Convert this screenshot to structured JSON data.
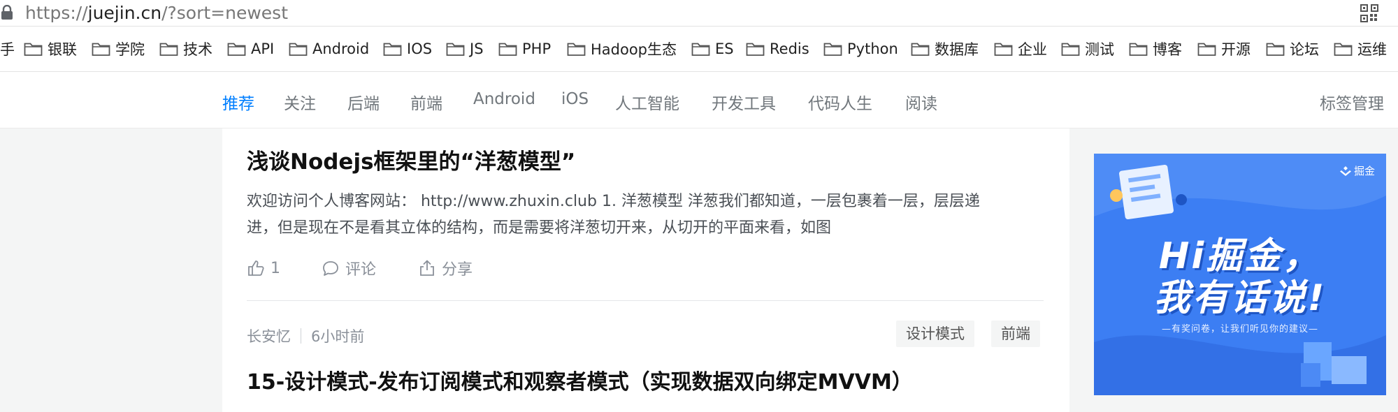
{
  "address_bar": {
    "url_scheme": "https://",
    "url_domain": "juejin.cn",
    "url_path": "/?sort=newest"
  },
  "bookmarks": [
    {
      "label": "手"
    },
    {
      "label": "银联"
    },
    {
      "label": "学院"
    },
    {
      "label": "技术"
    },
    {
      "label": "API"
    },
    {
      "label": "Android"
    },
    {
      "label": "IOS"
    },
    {
      "label": "JS"
    },
    {
      "label": "PHP"
    },
    {
      "label": "Hadoop生态"
    },
    {
      "label": "ES"
    },
    {
      "label": "Redis"
    },
    {
      "label": "Python"
    },
    {
      "label": "数据库"
    },
    {
      "label": "企业"
    },
    {
      "label": "测试"
    },
    {
      "label": "博客"
    },
    {
      "label": "开源"
    },
    {
      "label": "论坛"
    },
    {
      "label": "运维"
    }
  ],
  "nav": {
    "tabs": [
      {
        "label": "推荐",
        "active": true
      },
      {
        "label": "关注"
      },
      {
        "label": "后端"
      },
      {
        "label": "前端"
      },
      {
        "label": "Android"
      },
      {
        "label": "iOS"
      },
      {
        "label": "人工智能"
      },
      {
        "label": "开发工具"
      },
      {
        "label": "代码人生"
      },
      {
        "label": "阅读"
      }
    ],
    "tag_manage": "标签管理"
  },
  "feed": {
    "article1": {
      "title": "浅谈Nodejs框架里的“洋葱模型”",
      "abstract_line1": "欢迎访问个人博客网站： http://www.zhuxin.club 1. 洋葱模型 洋葱我们都知道，一层包裹着一层，层层递",
      "abstract_line2": "进，但是现在不是看其立体的结构，而是需要将洋葱切开来，从切开的平面来看，如图",
      "like_count": "1",
      "comment_label": "评论",
      "share_label": "分享"
    },
    "article2": {
      "author": "长安忆",
      "time": "6小时前",
      "tags": [
        "设计模式",
        "前端"
      ],
      "title": "15-设计模式-发布订阅模式和观察者模式（实现数据双向绑定MVVM）"
    }
  },
  "ad": {
    "brand": "掘金",
    "headline_line1": "Hi掘金，",
    "headline_line2": "我有话说!",
    "subline": "—有奖问卷，让我们听见你的建议—"
  },
  "colors": {
    "accent": "#007fff",
    "ad_background": "#3c7ef3",
    "page_background": "#f4f5f5"
  }
}
